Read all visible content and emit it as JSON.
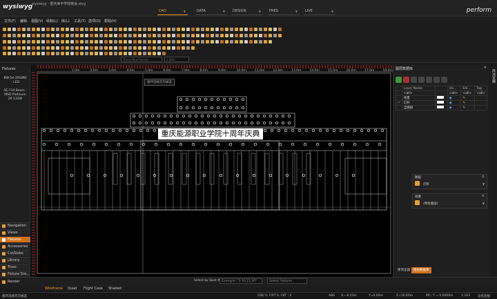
{
  "app": {
    "logo": "wysiwyg",
    "title": "wysiwyg - 重庆美丰学院晚会.wyg",
    "brand": "perform"
  },
  "modes": [
    {
      "label": "CAD",
      "active": true
    },
    {
      "label": "DATA",
      "active": false
    },
    {
      "label": "DESIGN",
      "active": false
    },
    {
      "label": "PRES",
      "active": false
    },
    {
      "label": "LIVE",
      "active": false
    }
  ],
  "menu": [
    "文件(F)",
    "编辑",
    "视图(V)",
    "绘制(L)",
    "库(L)",
    "工具(T)",
    "选项(O)",
    "帮助(H)"
  ],
  "toolbar": {
    "font_name": "Times New Roman",
    "line_weight": "1.00m"
  },
  "left_panel": {
    "title": "Fixtures",
    "fixture_1": [
      "BW-54-3RGBW",
      "- LED"
    ],
    "fixture_2": [
      "AE-710 Beam -",
      "MSD Platinum",
      "2R 132W"
    ],
    "nav": [
      {
        "label": "Navigation",
        "active": false
      },
      {
        "label": "Views",
        "active": false
      },
      {
        "label": "Fixtures",
        "active": true
      },
      {
        "label": "Accessories",
        "active": false
      },
      {
        "label": "Col/Gobo",
        "active": false
      },
      {
        "label": "Library",
        "active": false
      },
      {
        "label": "Truss",
        "active": false
      },
      {
        "label": "Fixture Gro...",
        "active": false
      }
    ],
    "render": "Render"
  },
  "viewport": {
    "banner": "重庆能源职业学院十周年庆典",
    "tooltip": "循环选择无可被选",
    "ruler_labels": [
      "1.0m",
      "2.0m",
      "3.0m",
      "4.0m",
      "5.0m",
      "6.0m",
      "7.0m",
      "8.0m",
      "9.0m",
      "10.0m",
      "11.0m",
      "12.0m",
      "13.0m",
      "14.0m",
      "15.0m",
      "16.0m",
      "17.0m",
      "18.0m",
      "19.0m"
    ]
  },
  "right_panel": {
    "title": "图层数据库",
    "columns": [
      "Layer Name",
      "Vis...",
      "Edi...",
      "Tag"
    ],
    "filter": "<all>",
    "filter_vis": "<all>",
    "filter_edit": "<all>",
    "filter_tag": "<all>",
    "layers": [
      {
        "name": "场景"
      },
      {
        "name": "灯杆"
      },
      {
        "name": "全图层"
      }
    ],
    "box_layer": {
      "title": "图层",
      "value": "灯杆"
    },
    "box_scene": {
      "title": "场景",
      "value": "(所有图层)"
    },
    "tabs": [
      {
        "label": "库浏览器",
        "active": false
      },
      {
        "label": "图层数据库",
        "active": true
      }
    ],
    "side_label": "库浏览器"
  },
  "view_tabs": [
    {
      "label": "Wireframe",
      "active": true
    },
    {
      "label": "Quad",
      "active": false
    },
    {
      "label": "Flight Case",
      "active": false
    },
    {
      "label": "Shaded",
      "active": false
    }
  ],
  "selection": {
    "by_spot": "Select by Spot #:",
    "example": "Example: \"1-10,15,20\"",
    "fixtures": "Select Fixtures"
  },
  "status": {
    "message": "循环选择无可被选",
    "counts": "O/B/  0, FIXT 0, CKT : 0",
    "abs": "ABS",
    "x": "X=-8.43m",
    "y": "Y=0.00m",
    "z": "Z=16.60m",
    "mc": "MC: Y = 0.0000m",
    "zoom": "1:163",
    "connected": "没有连接"
  }
}
